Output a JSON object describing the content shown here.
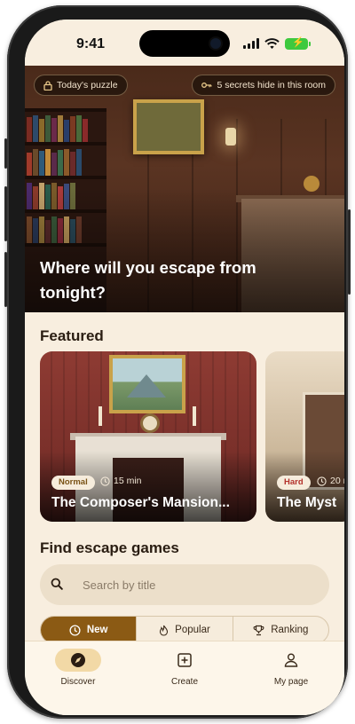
{
  "status_bar": {
    "time": "9:41",
    "battery_icon": "battery-charging-icon"
  },
  "hero": {
    "badge_left": "Today's puzzle",
    "badge_right": "5 secrets hide in this room",
    "headline": "Where will you escape from tonight?"
  },
  "featured": {
    "title": "Featured",
    "cards": [
      {
        "difficulty": "Normal",
        "duration": "15 min",
        "title": "The Composer's Mansion...",
        "difficulty_color": "#7a5316"
      },
      {
        "difficulty": "Hard",
        "duration": "20 m",
        "title": "The Myst",
        "difficulty_color": "#b3312b"
      }
    ]
  },
  "find": {
    "title": "Find escape games",
    "search_placeholder": "Search by title"
  },
  "tabs": [
    {
      "label": "New",
      "icon": "clock-icon",
      "active": true
    },
    {
      "label": "Popular",
      "icon": "flame-icon",
      "active": false
    },
    {
      "label": "Ranking",
      "icon": "trophy-icon",
      "active": false
    }
  ],
  "bottom_nav": [
    {
      "label": "Discover",
      "icon": "compass-icon",
      "active": true
    },
    {
      "label": "Create",
      "icon": "plus-square-icon",
      "active": false
    },
    {
      "label": "My page",
      "icon": "person-icon",
      "active": false
    }
  ],
  "colors": {
    "accent": "#8b5a14",
    "background": "#f8eedf",
    "search_bg": "#ecdfca"
  }
}
